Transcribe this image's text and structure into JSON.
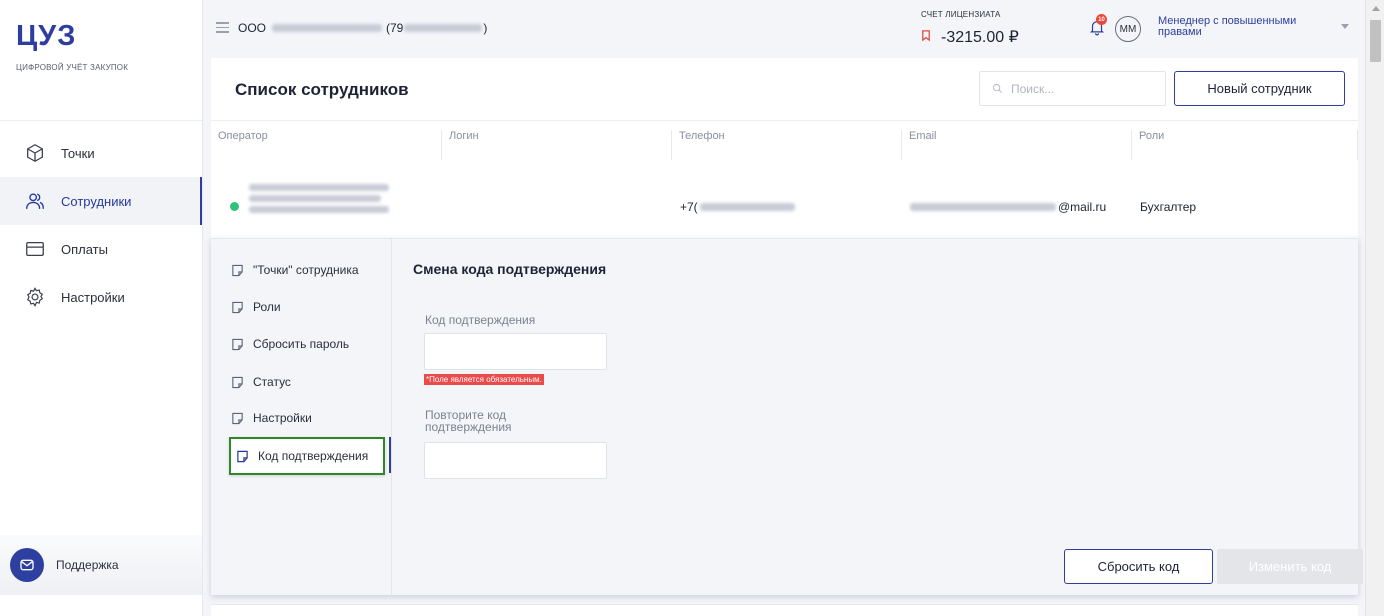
{
  "sidebar": {
    "logo": "ЦУЗ",
    "logo_subtitle": "ЦИФРОВОЙ УЧЁТ ЗАКУПОК",
    "items": [
      {
        "label": "Точки",
        "icon": "cube-icon"
      },
      {
        "label": "Сотрудники",
        "icon": "users-icon",
        "active": true
      },
      {
        "label": "Оплаты",
        "icon": "card-icon"
      },
      {
        "label": "Настройки",
        "icon": "gear-icon"
      }
    ],
    "support_label": "Поддержка"
  },
  "header": {
    "org_prefix": "ООО",
    "org_suffix_open": "(79",
    "org_suffix_close": ")",
    "account_label": "СЧЕТ ЛИЦЕНЗИАТА",
    "account_value": "-3215.00 ₽",
    "notification_count": "10",
    "avatar_initials": "ММ",
    "user_role": "Менеднер с повышенными правами"
  },
  "main": {
    "title": "Список сотрудников",
    "search_placeholder": "Поиск...",
    "new_button": "Новый сотрудник",
    "columns": [
      "Оператор",
      "Логин",
      "Телефон",
      "Email",
      "Роли"
    ],
    "row": {
      "status": "active",
      "phone_prefix": "+7(",
      "email_suffix": "@mail.ru",
      "role": "Бухгалтер"
    }
  },
  "panel": {
    "menu": [
      "\"Точки\" сотрудника",
      "Роли",
      "Сбросить пароль",
      "Статус",
      "Настройки",
      "Код подтверждения"
    ],
    "form_title": "Смена кода подтверждения",
    "field1_label": "Код подтверждения",
    "field1_error": "*Поле является обязательным.",
    "field2_label": "Повторите код подтверждения",
    "reset_button": "Сбросить код",
    "change_button": "Изменить код"
  },
  "colors": {
    "brand": "#2d3f9f",
    "active_status": "#2fc27a",
    "error": "#ea4a4a",
    "highlight": "#2a8a2a"
  }
}
